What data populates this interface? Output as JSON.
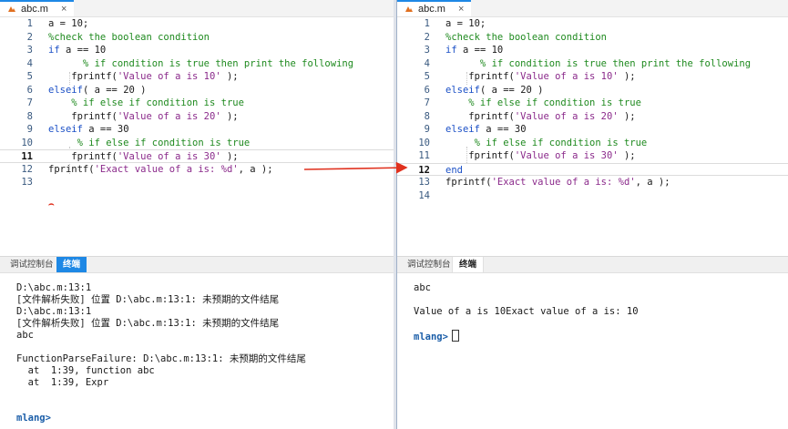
{
  "left": {
    "tab": {
      "filename": "abc.m",
      "close": "×"
    },
    "lines": [
      {
        "n": "1",
        "parts": [
          [
            "pl",
            "a = 10;"
          ]
        ]
      },
      {
        "n": "2",
        "parts": [
          [
            "cm",
            "%check the boolean condition"
          ]
        ]
      },
      {
        "n": "3",
        "parts": [
          [
            "kw",
            "if"
          ],
          [
            "pl",
            " a == 10"
          ]
        ]
      },
      {
        "n": "4",
        "parts": [
          [
            "cm",
            "      % if condition is true then print the following"
          ]
        ]
      },
      {
        "n": "5",
        "parts": [
          [
            "pl",
            "    fprintf("
          ],
          [
            "st",
            "'Value of a is 10'"
          ],
          [
            "pl",
            " );"
          ]
        ]
      },
      {
        "n": "6",
        "parts": [
          [
            "kw",
            "elseif"
          ],
          [
            "pl",
            "( a == 20 )"
          ]
        ]
      },
      {
        "n": "7",
        "parts": [
          [
            "cm",
            "    % if else if condition is true"
          ]
        ]
      },
      {
        "n": "8",
        "parts": [
          [
            "pl",
            "    fprintf("
          ],
          [
            "st",
            "'Value of a is 20'"
          ],
          [
            "pl",
            " );"
          ]
        ]
      },
      {
        "n": "9",
        "parts": [
          [
            "kw",
            "elseif"
          ],
          [
            "pl",
            " a == 30"
          ]
        ]
      },
      {
        "n": "10",
        "parts": [
          [
            "cm",
            "     % if else if condition is true"
          ]
        ]
      },
      {
        "n": "11",
        "parts": [
          [
            "pl",
            "    fprintf("
          ],
          [
            "st",
            "'Value of a is 30'"
          ],
          [
            "pl",
            " );"
          ]
        ]
      },
      {
        "n": "12",
        "parts": [
          [
            "pl",
            "fprintf("
          ],
          [
            "st",
            "'Exact value of a is: %d'"
          ],
          [
            "pl",
            ", a );"
          ]
        ]
      },
      {
        "n": "13",
        "parts": []
      }
    ],
    "error_marker": "⌢",
    "bottom_tabs": [
      "调试控制台",
      "终端"
    ],
    "console": [
      "D:\\abc.m:13:1",
      "[文件解析失败] 位置 D:\\abc.m:13:1: 未预期的文件结尾",
      "D:\\abc.m:13:1",
      "[文件解析失败] 位置 D:\\abc.m:13:1: 未预期的文件结尾",
      "abc",
      "",
      "FunctionParseFailure: D:\\abc.m:13:1: 未预期的文件结尾",
      "  at  1:39, function abc",
      "  at  1:39, Expr",
      "",
      "",
      "mlang>"
    ]
  },
  "right": {
    "tab": {
      "filename": "abc.m",
      "close": "×"
    },
    "lines": [
      {
        "n": "1",
        "parts": [
          [
            "pl",
            "a = 10;"
          ]
        ]
      },
      {
        "n": "2",
        "parts": [
          [
            "cm",
            "%check the boolean condition"
          ]
        ]
      },
      {
        "n": "3",
        "parts": [
          [
            "kw",
            "if"
          ],
          [
            "pl",
            " a == 10"
          ]
        ]
      },
      {
        "n": "4",
        "parts": [
          [
            "cm",
            "      % if condition is true then print the following"
          ]
        ]
      },
      {
        "n": "5",
        "parts": [
          [
            "pl",
            "    fprintf("
          ],
          [
            "st",
            "'Value of a is 10'"
          ],
          [
            "pl",
            " );"
          ]
        ]
      },
      {
        "n": "6",
        "parts": [
          [
            "kw",
            "elseif"
          ],
          [
            "pl",
            "( a == 20 )"
          ]
        ]
      },
      {
        "n": "7",
        "parts": [
          [
            "cm",
            "    % if else if condition is true"
          ]
        ]
      },
      {
        "n": "8",
        "parts": [
          [
            "pl",
            "    fprintf("
          ],
          [
            "st",
            "'Value of a is 20'"
          ],
          [
            "pl",
            " );"
          ]
        ]
      },
      {
        "n": "9",
        "parts": [
          [
            "kw",
            "elseif"
          ],
          [
            "pl",
            " a == 30"
          ]
        ]
      },
      {
        "n": "10",
        "parts": [
          [
            "cm",
            "     % if else if condition is true"
          ]
        ]
      },
      {
        "n": "11",
        "parts": [
          [
            "pl",
            "    fprintf("
          ],
          [
            "st",
            "'Value of a is 30'"
          ],
          [
            "pl",
            " );"
          ]
        ]
      },
      {
        "n": "12",
        "parts": [
          [
            "kw",
            "end"
          ]
        ]
      },
      {
        "n": "13",
        "parts": [
          [
            "pl",
            "fprintf("
          ],
          [
            "st",
            "'Exact value of a is: %d'"
          ],
          [
            "pl",
            ", a );"
          ]
        ]
      },
      {
        "n": "14",
        "parts": []
      }
    ],
    "bottom_tabs": [
      "调试控制台",
      "终端"
    ],
    "console": [
      "abc",
      "",
      "Value of a is 10Exact value of a is: 10",
      "",
      "mlang>"
    ]
  },
  "colors": {
    "keyword": "#1a4fc6",
    "comment": "#1f8a1f",
    "string": "#8b2a8b",
    "accent": "#1e88e5",
    "arrow": "#e0311e"
  }
}
